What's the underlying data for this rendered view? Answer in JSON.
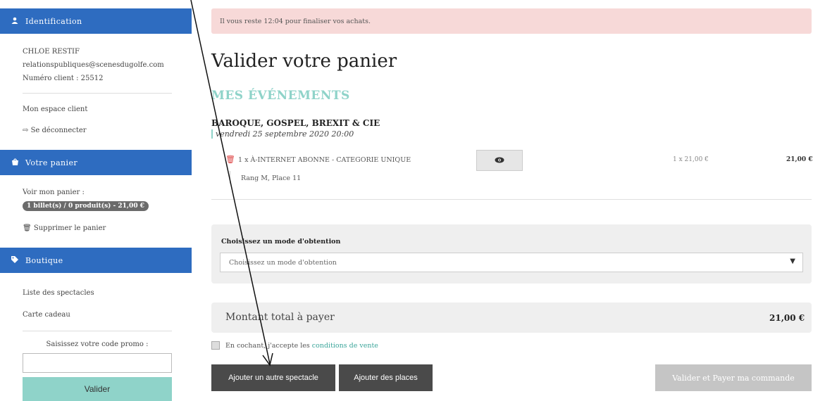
{
  "sidebar": {
    "identification": {
      "title": "Identification",
      "icon": "user-icon"
    },
    "user": {
      "name": "CHLOE RESTIF",
      "email": "relationspubliques@scenesdugolfe.com",
      "client_number": "Numéro client : 25512"
    },
    "account_link": "Mon espace client",
    "logout_link": "Se déconnecter",
    "cart": {
      "title": "Votre panier",
      "icon": "shopping-bag-icon",
      "view_label": "Voir mon panier :",
      "badge": "1 billet(s) / 0 produit(s) - 21,00 €",
      "delete_link": "Supprimer le panier"
    },
    "shop": {
      "title": "Boutique",
      "icon": "tag-icon",
      "items": [
        "Liste des spectacles",
        "Carte cadeau"
      ]
    },
    "promo": {
      "label": "Saisissez votre code promo :",
      "placeholder": "",
      "button": "Valider"
    }
  },
  "main": {
    "alert": "Il vous reste 12:04 pour finaliser vos achats.",
    "title": "Valider votre panier",
    "events_heading": "MES ÉVÉNEMENTS",
    "event": {
      "title": "BAROQUE, GOSPEL, BREXIT & CIE",
      "date": "vendredi 25 septembre 2020 20:00",
      "line_prefix": "1 x",
      "line_label": "À-INTERNET ABONNE - CATEGORIE UNIQUE",
      "seat": "Rang M, Place 11",
      "unit_price": "1 x 21,00 €",
      "total": "21,00 €"
    },
    "delivery": {
      "label": "Choisissez un mode d'obtention",
      "placeholder": "Choisissez un mode d'obtention"
    },
    "total": {
      "label": "Montant total à payer",
      "value": "21,00 €"
    },
    "terms": {
      "prefix": "En cochant, j'accepte les",
      "link": "conditions de vente"
    },
    "buttons": {
      "add_show": "Ajouter un autre spectacle",
      "add_seats": "Ajouter des places",
      "pay": "Valider et Payer ma commande"
    }
  },
  "colors": {
    "primary": "#2e6cc0",
    "accent": "#8fd3c9",
    "alert_bg": "#f7d9d8",
    "dark_button": "#4a4a4a"
  }
}
